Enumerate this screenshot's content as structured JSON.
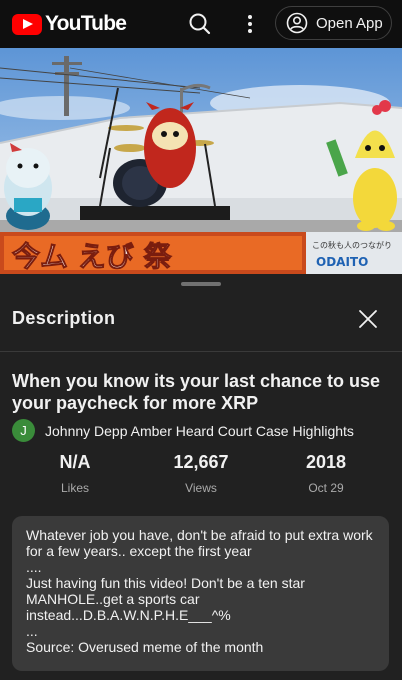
{
  "header": {
    "logo_text": "YouTube",
    "open_app_label": "Open App",
    "brand_color": "#ff0000",
    "icons": [
      "youtube-logo-icon",
      "search-icon",
      "more-vert-icon",
      "account-icon"
    ]
  },
  "sheet": {
    "title": "Description",
    "close_icon": "close-icon",
    "video_title": "When you know its your last chance to use your paycheck for more XRP",
    "channel": {
      "avatar_letter": "J",
      "name": "Johnny Depp Amber Heard Court Case Highlights"
    },
    "stats": [
      {
        "value": "N/A",
        "label": "Likes"
      },
      {
        "value": "12,667",
        "label": "Views"
      },
      {
        "value": "2018",
        "label": "Oct 29"
      }
    ],
    "description_lines": [
      "Whatever job you have, don't be afraid to put extra work",
      "for a few years.. except the first year",
      "....",
      "Just having fun this video! Don't be a ten star",
      "MANHOLE..get a sports car",
      "instead...D.B.A.W.N.P.H.E___^%",
      "...",
      "Source: Overused meme of the month"
    ]
  }
}
